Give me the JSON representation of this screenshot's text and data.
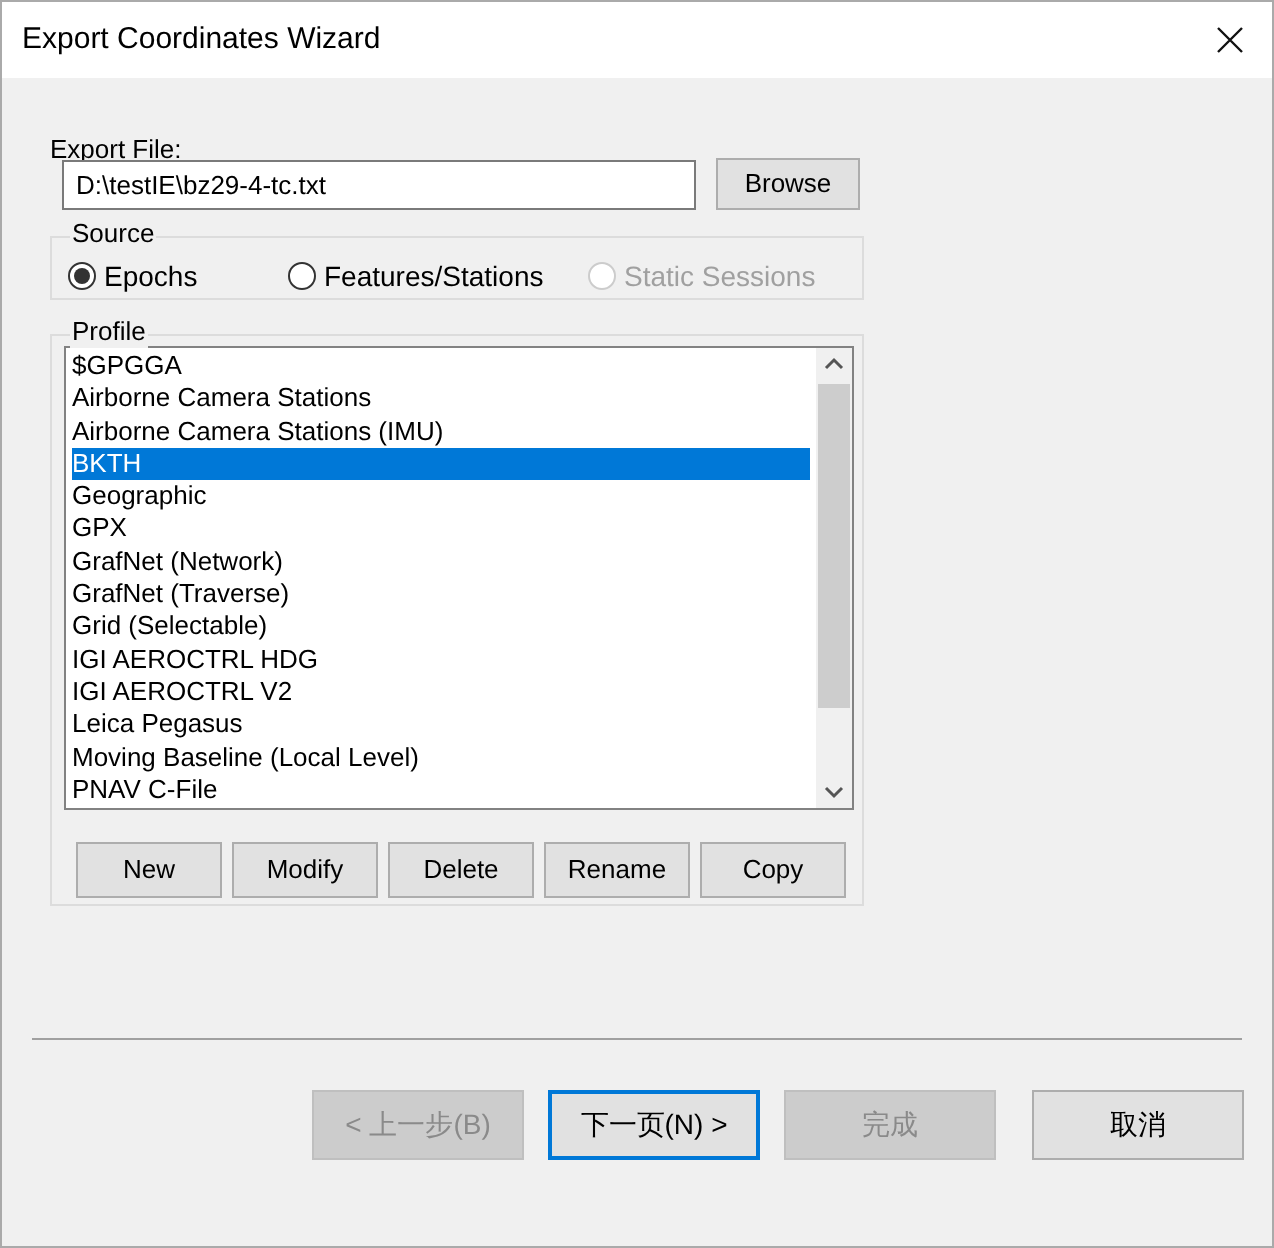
{
  "window": {
    "title": "Export Coordinates Wizard"
  },
  "export_file": {
    "label": "Export File:",
    "value": "D:\\testIE\\bz29-4-tc.txt",
    "browse_button": "Browse"
  },
  "source": {
    "title": "Source",
    "options": [
      {
        "label": "Epochs",
        "selected": true,
        "disabled": false
      },
      {
        "label": "Features/Stations",
        "selected": false,
        "disabled": false
      },
      {
        "label": "Static Sessions",
        "selected": false,
        "disabled": true
      }
    ]
  },
  "profile": {
    "title": "Profile",
    "items": [
      {
        "label": "$GPGGA",
        "selected": false
      },
      {
        "label": "Airborne Camera Stations",
        "selected": false
      },
      {
        "label": "Airborne Camera Stations (IMU)",
        "selected": false
      },
      {
        "label": "BKTH",
        "selected": true
      },
      {
        "label": "Geographic",
        "selected": false
      },
      {
        "label": "GPX",
        "selected": false
      },
      {
        "label": "GrafNet (Network)",
        "selected": false
      },
      {
        "label": "GrafNet (Traverse)",
        "selected": false
      },
      {
        "label": "Grid (Selectable)",
        "selected": false
      },
      {
        "label": "IGI AEROCTRL HDG",
        "selected": false
      },
      {
        "label": "IGI AEROCTRL V2",
        "selected": false
      },
      {
        "label": "Leica Pegasus",
        "selected": false
      },
      {
        "label": "Moving Baseline (Local Level)",
        "selected": false
      },
      {
        "label": "PNAV C-File",
        "selected": false
      }
    ],
    "buttons": [
      "New",
      "Modify",
      "Delete",
      "Rename",
      "Copy"
    ]
  },
  "footer_buttons": [
    {
      "label": "< 上一步(B)",
      "disabled": true,
      "default": false
    },
    {
      "label": "下一页(N) >",
      "disabled": false,
      "default": true
    },
    {
      "label": "完成",
      "disabled": true,
      "default": false
    },
    {
      "label": "取消",
      "disabled": false,
      "default": false
    }
  ]
}
